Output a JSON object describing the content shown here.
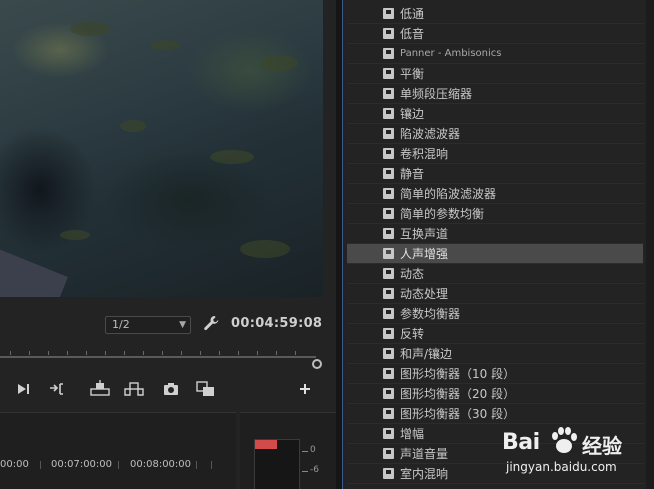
{
  "monitor": {
    "resolution": "1/2",
    "timecode": "00:04:59:08"
  },
  "timeline": {
    "labels": [
      "00:00",
      "00:07:00:00",
      "00:08:00:00"
    ]
  },
  "audio_meter": {
    "levels": [
      "0",
      "-6"
    ]
  },
  "effects": {
    "items": [
      {
        "label": "低通"
      },
      {
        "label": "低音"
      },
      {
        "label": "Panner - Ambisonics"
      },
      {
        "label": "平衡"
      },
      {
        "label": "单频段压缩器"
      },
      {
        "label": "镶边"
      },
      {
        "label": "陷波滤波器"
      },
      {
        "label": "卷积混响"
      },
      {
        "label": "静音"
      },
      {
        "label": "简单的陷波滤波器"
      },
      {
        "label": "简单的参数均衡"
      },
      {
        "label": "互换声道"
      },
      {
        "label": "人声增强",
        "selected": true
      },
      {
        "label": "动态"
      },
      {
        "label": "动态处理"
      },
      {
        "label": "参数均衡器"
      },
      {
        "label": "反转"
      },
      {
        "label": "和声/镶边"
      },
      {
        "label": "图形均衡器（10 段）"
      },
      {
        "label": "图形均衡器（20 段）"
      },
      {
        "label": "图形均衡器（30 段）"
      },
      {
        "label": "增幅"
      },
      {
        "label": "声道音量"
      },
      {
        "label": "室内混响"
      }
    ]
  },
  "watermark": {
    "brand_latin": "Bai",
    "brand_cn": "经验",
    "url": "jingyan.baidu.com"
  }
}
